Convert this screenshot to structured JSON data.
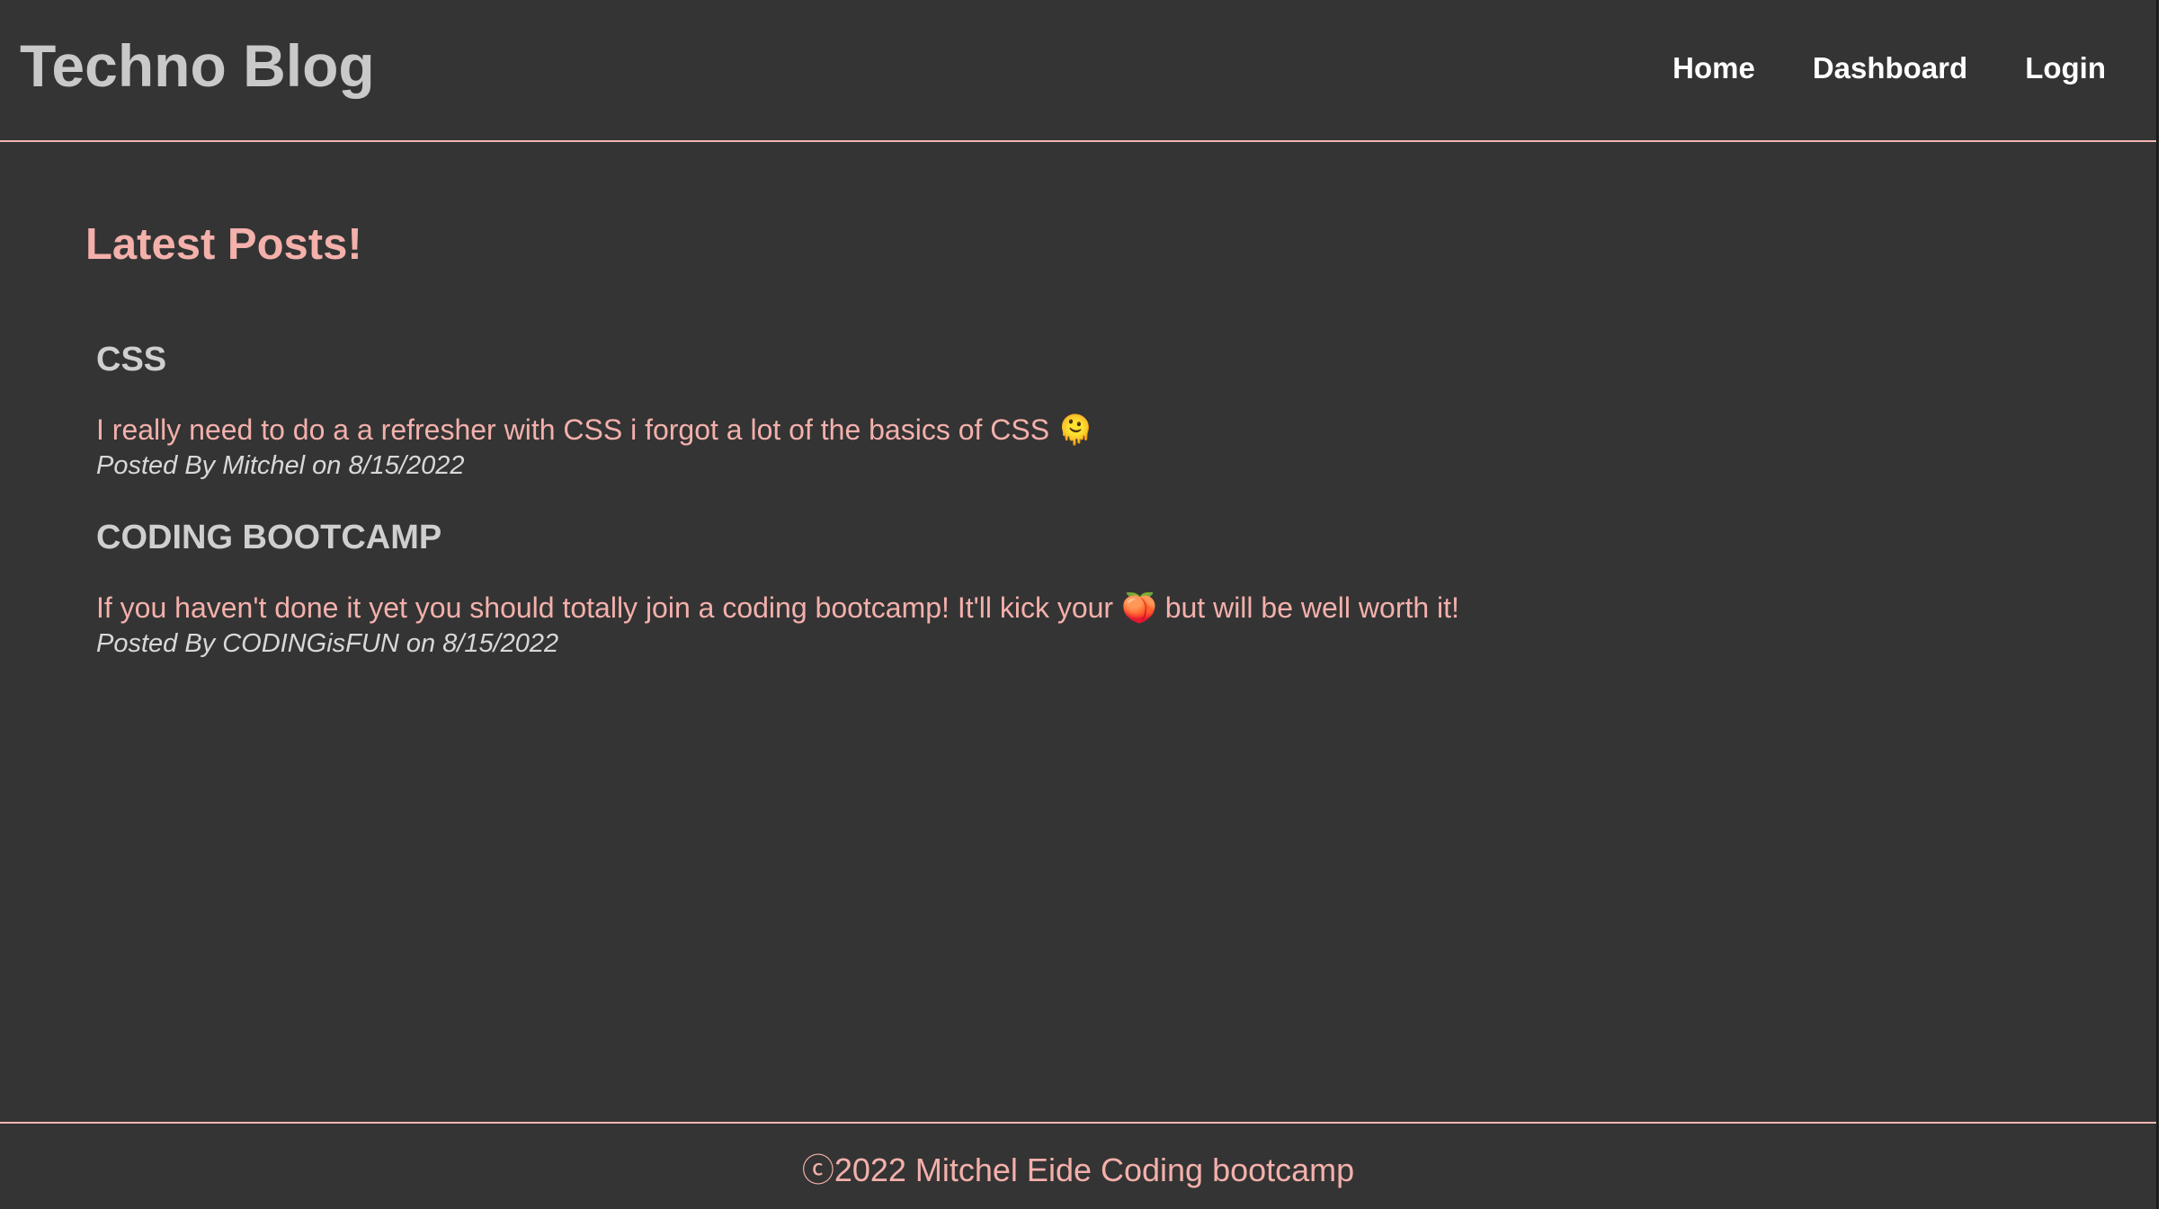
{
  "header": {
    "site_title": "Techno Blog",
    "nav": [
      "Home",
      "Dashboard",
      "Login"
    ]
  },
  "main": {
    "section_title": "Latest Posts!",
    "posts": [
      {
        "title": "CSS",
        "body": "I really need to do a a refresher with CSS i forgot a lot of the basics of CSS 🫠",
        "meta": "Posted By Mitchel on 8/15/2022"
      },
      {
        "title": "CODING BOOTCAMP",
        "body": "If you haven't done it yet you should totally join a coding bootcamp! It'll kick your 🍑 but will be well worth it!",
        "meta": "Posted By CODINGisFUN on 8/15/2022"
      }
    ]
  },
  "footer": {
    "text": "ⓒ2022 Mitchel Eide Coding bootcamp"
  },
  "colors": {
    "background": "#343434",
    "accent": "#f4b0ab",
    "title": "#c9c9c9",
    "nav": "#ffffff"
  }
}
